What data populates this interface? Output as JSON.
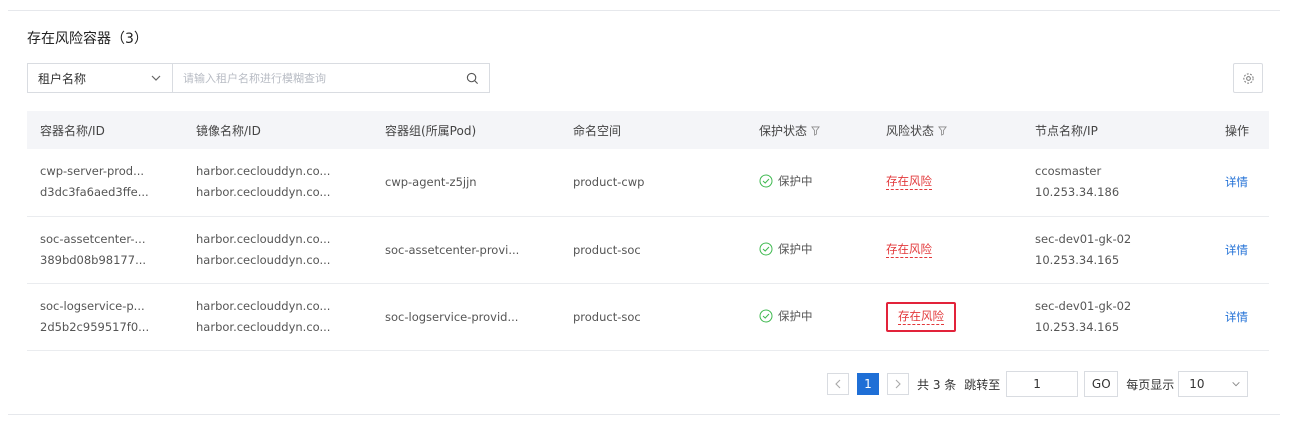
{
  "section_title": "存在风险容器（3）",
  "filter": {
    "select_label": "租户名称",
    "search_placeholder": "请输入租户名称进行模糊查询"
  },
  "table": {
    "headers": [
      "容器名称/ID",
      "镜像名称/ID",
      "容器组(所属Pod)",
      "命名空间",
      "保护状态",
      "风险状态",
      "节点名称/IP",
      "操作"
    ],
    "rows": [
      {
        "container_name": "cwp-server-prod...",
        "container_id": "d3dc3fa6aed3ffe...",
        "image_name": "harbor.ceclouddyn.co...",
        "image_id": "harbor.ceclouddyn.co...",
        "pod": "cwp-agent-z5jjn",
        "namespace": "product-cwp",
        "protect_status": "保护中",
        "risk_status": "存在风险",
        "node_name": "ccosmaster",
        "node_ip": "10.253.34.186",
        "action": "详情"
      },
      {
        "container_name": "soc-assetcenter-...",
        "container_id": "389bd08b98177...",
        "image_name": "harbor.ceclouddyn.co...",
        "image_id": "harbor.ceclouddyn.co...",
        "pod": "soc-assetcenter-provi...",
        "namespace": "product-soc",
        "protect_status": "保护中",
        "risk_status": "存在风险",
        "node_name": "sec-dev01-gk-02",
        "node_ip": "10.253.34.165",
        "action": "详情"
      },
      {
        "container_name": "soc-logservice-p...",
        "container_id": "2d5b2c959517f0...",
        "image_name": "harbor.ceclouddyn.co...",
        "image_id": "harbor.ceclouddyn.co...",
        "pod": "soc-logservice-provid...",
        "namespace": "product-soc",
        "protect_status": "保护中",
        "risk_status": "存在风险",
        "node_name": "sec-dev01-gk-02",
        "node_ip": "10.253.34.165",
        "action": "详情"
      }
    ]
  },
  "pagination": {
    "current_page": "1",
    "total_text": "共 3 条",
    "jump_label": "跳转至",
    "jump_value": "1",
    "go_label": "GO",
    "per_page_label": "每页显示",
    "per_page_value": "10"
  },
  "colors": {
    "accent": "#1f6fd6",
    "risk": "#e2383a",
    "protect_ok": "#3fb950",
    "header_bg": "#f4f5f8"
  }
}
